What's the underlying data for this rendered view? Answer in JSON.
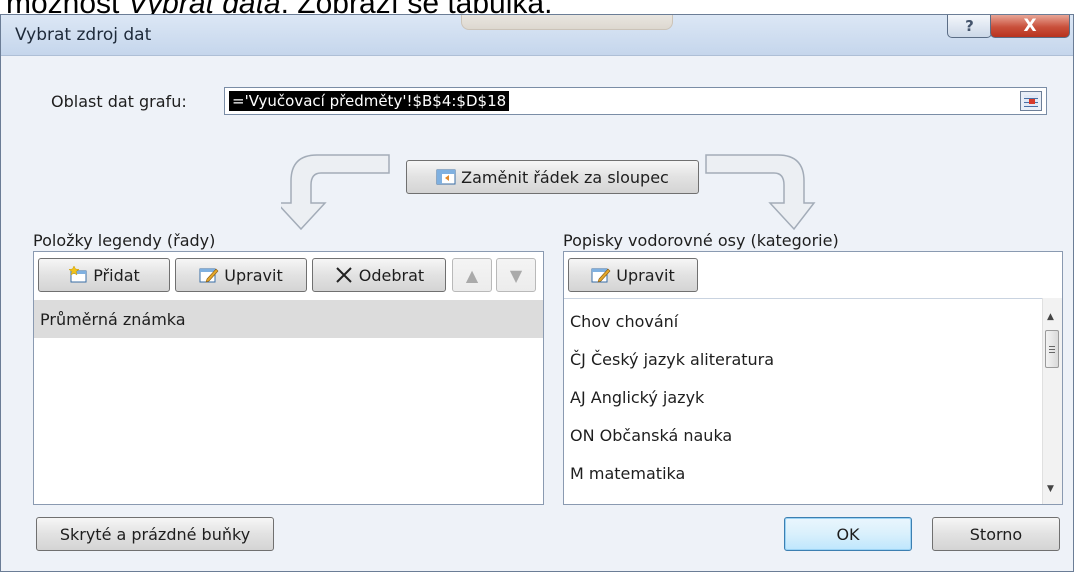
{
  "page_caption": {
    "prefix": "možnost ",
    "italic": "Vybrat data",
    "suffix": ". Zobrazí se tabulka."
  },
  "dialog": {
    "title": "Vybrat zdroj dat",
    "help_label": "?",
    "close_label": "X"
  },
  "range": {
    "label": "Oblast dat grafu:",
    "value": "='Vyučovací předměty'!$B$4:$D$18"
  },
  "switch_button": "Zaměnit řádek za sloupec",
  "legend": {
    "heading": "Položky legendy (řady)",
    "add": "Přidat",
    "edit": "Upravit",
    "remove": "Odebrat",
    "items": [
      "Průměrná známka"
    ]
  },
  "axis": {
    "heading": "Popisky vodorovné osy (kategorie)",
    "edit": "Upravit",
    "items": [
      "Chov chování",
      "ČJ Český jazyk aliteratura",
      "AJ Anglický jazyk",
      "ON Občanská nauka",
      "M matematika"
    ]
  },
  "footer": {
    "hidden_cells": "Skryté a prázdné buňky",
    "ok": "OK",
    "cancel": "Storno"
  },
  "colors": {
    "close_red": "#c9503b",
    "selection": "#dcdcdc",
    "dialog_bg": "#eef2f8"
  },
  "icons": [
    "collapse-dialog-icon",
    "switch-row-column-icon",
    "add-series-icon",
    "edit-icon",
    "remove-x-icon",
    "move-up-icon",
    "move-down-icon"
  ]
}
